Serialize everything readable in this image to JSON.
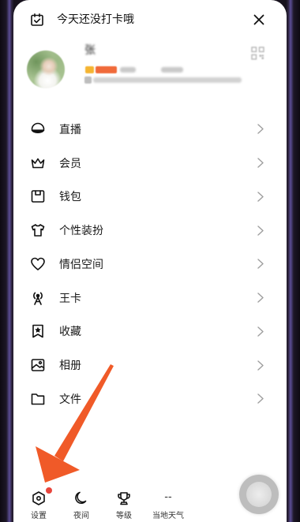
{
  "checkin": {
    "text": "今天还没打卡哦",
    "icon": "calendar-check-icon"
  },
  "close_icon": "close-icon",
  "profile": {
    "name": "张",
    "qr_icon": "qr-code-icon"
  },
  "menu": [
    {
      "label": "直播",
      "icon": "live-icon"
    },
    {
      "label": "会员",
      "icon": "crown-icon"
    },
    {
      "label": "钱包",
      "icon": "wallet-icon"
    },
    {
      "label": "个性装扮",
      "icon": "tshirt-icon"
    },
    {
      "label": "情侣空间",
      "icon": "heart-icon"
    },
    {
      "label": "王卡",
      "icon": "antenna-icon"
    },
    {
      "label": "收藏",
      "icon": "bookmark-star-icon"
    },
    {
      "label": "相册",
      "icon": "photo-album-icon"
    },
    {
      "label": "文件",
      "icon": "folder-icon"
    }
  ],
  "bottom_bar": [
    {
      "label": "设置",
      "icon": "settings-icon",
      "has_notification_dot": true
    },
    {
      "label": "夜间",
      "icon": "moon-icon"
    },
    {
      "label": "等级",
      "icon": "trophy-icon"
    },
    {
      "label": "当地天气",
      "value": "--"
    }
  ],
  "colors": {
    "background": "#ffffff",
    "text": "#1a1a1a",
    "chevron": "#9e9e9e",
    "notification_dot": "#e8453c",
    "annotation_arrow": "#f05a28",
    "badge_vip": "#f5b431",
    "badge_level": "#f06a3a"
  }
}
